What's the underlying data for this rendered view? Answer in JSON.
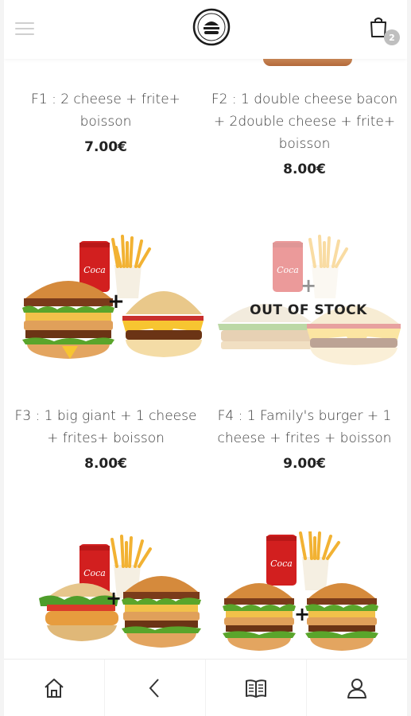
{
  "header": {
    "menu_icon": "hamburger-menu-icon",
    "logo_icon": "burger-logo-icon",
    "cart_icon": "shopping-bag-icon",
    "cart_count": "2"
  },
  "products": [
    {
      "name": "F1 : 2 cheese + frite+ boisson",
      "price": "7.00€",
      "out_of_stock": ""
    },
    {
      "name": "F2 : 1 double cheese bacon + 2double cheese + frite+ boisson",
      "price": "8.00€",
      "out_of_stock": ""
    },
    {
      "name": "F3 : 1 big giant + 1 cheese + frites+ boisson",
      "price": "8.00€",
      "out_of_stock": ""
    },
    {
      "name": "F4 : 1 Family's burger + 1 cheese + frites + boisson",
      "price": "9.00€",
      "out_of_stock": "OUT OF STOCK"
    }
  ],
  "bottom_nav": [
    {
      "icon": "home-icon"
    },
    {
      "icon": "back-chevron-icon"
    },
    {
      "icon": "menu-book-icon"
    },
    {
      "icon": "user-icon"
    }
  ],
  "colors": {
    "accent": "#222222",
    "badge": "#bfbfbf",
    "coke_red": "#d21f1f",
    "fries": "#f2b233"
  }
}
